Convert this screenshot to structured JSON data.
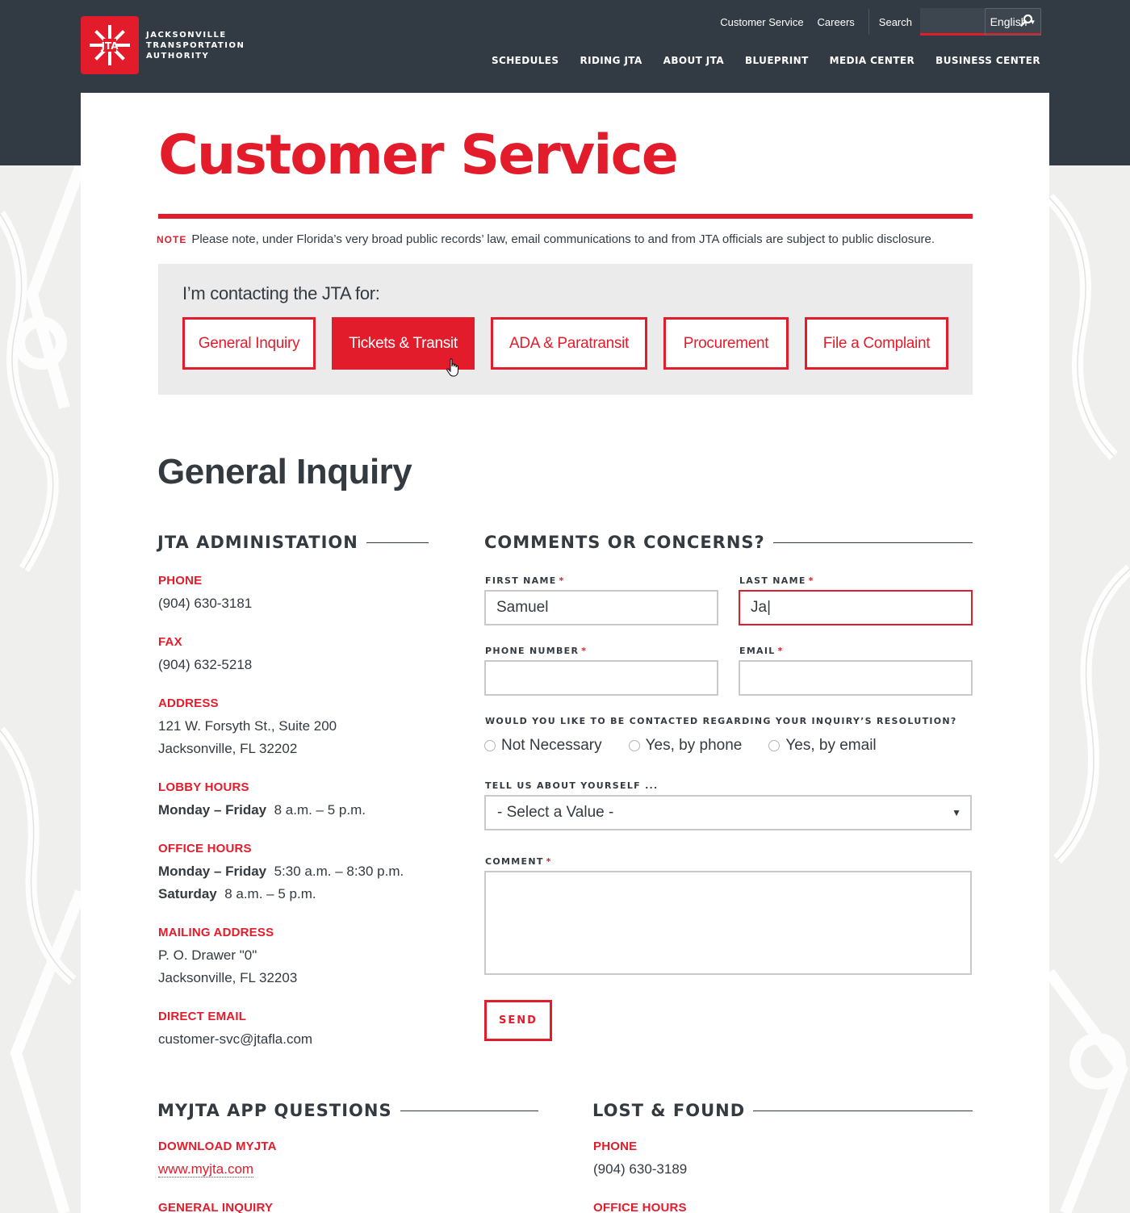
{
  "header": {
    "logo_lines": [
      "Jacksonville",
      "Transportation",
      "Authority"
    ],
    "utility_links": [
      "Customer Service",
      "Careers"
    ],
    "search_label": "Search",
    "search_value": "",
    "language": "English",
    "nav": [
      "SCHEDULES",
      "RIDING JTA",
      "ABOUT JTA",
      "BLUEPRINT",
      "MEDIA CENTER",
      "BUSINESS CENTER"
    ]
  },
  "page": {
    "title": "Customer Service",
    "note_tag": "NOTE",
    "note_text": "Please note, under Florida’s very broad public records’ law, email communications to and from JTA officials are subject to public disclosure."
  },
  "contact": {
    "prompt": "I’m contacting the JTA for:",
    "options": [
      {
        "label": "General Inquiry",
        "active": false
      },
      {
        "label": "Tickets & Transit",
        "active": true
      },
      {
        "label": "ADA & Paratransit",
        "active": false
      },
      {
        "label": "Procurement",
        "active": false
      },
      {
        "label": "File a Complaint",
        "active": false
      }
    ]
  },
  "section_heading": "General Inquiry",
  "administration": {
    "heading": "JTA ADMINISTATION",
    "phone_label": "PHONE",
    "phone": "(904) 630-3181",
    "fax_label": "FAX",
    "fax": "(904) 632-5218",
    "address_label": "ADDRESS",
    "address_line1": "121 W. Forsyth St., Suite 200",
    "address_line2": "Jacksonville, FL 32202",
    "lobby_label": "LOBBY HOURS",
    "lobby_days": "Monday – Friday",
    "lobby_time": "8 a.m. – 5 p.m.",
    "office_label": "OFFICE HOURS",
    "office_days1": "Monday – Friday",
    "office_time1": "5:30 a.m. – 8:30 p.m.",
    "office_days2": "Saturday",
    "office_time2": "8 a.m. – 5 p.m.",
    "mailing_label": "MAILING ADDRESS",
    "mailing_line1": "P. O. Drawer \"0\"",
    "mailing_line2": "Jacksonville, FL 32203",
    "email_label": "DIRECT EMAIL",
    "email": "customer-svc@jtafla.com"
  },
  "form": {
    "heading": "COMMENTS OR CONCERNS?",
    "first_name_label": "FIRST NAME",
    "first_name_value": "Samuel",
    "last_name_label": "LAST NAME",
    "last_name_value": "Ja|",
    "phone_label": "PHONE NUMBER",
    "phone_value": "",
    "email_label": "EMAIL",
    "email_value": "",
    "required_mark": "*",
    "contact_question": "WOULD YOU LIKE TO BE CONTACTED REGARDING YOUR INQUIRY’S RESOLUTION?",
    "contact_options": [
      "Not Necessary",
      "Yes, by phone",
      "Yes, by email"
    ],
    "about_label": "TELL US ABOUT YOURSELF ...",
    "about_value": "- Select a Value -",
    "comment_label": "COMMENT",
    "send_label": "SEND"
  },
  "myjta": {
    "heading": "MYJTA APP QUESTIONS",
    "download_label": "DOWNLOAD MYJTA",
    "download_link": "www.myjta.com",
    "general_label": "GENERAL INQUIRY"
  },
  "lost_found": {
    "heading": "LOST & FOUND",
    "phone_label": "PHONE",
    "phone": "(904) 630-3189",
    "office_label": "OFFICE HOURS"
  },
  "colors": {
    "accent": "#e31c2b",
    "header_bg": "#323b43",
    "text": "#333a40",
    "panel": "#ebebeb"
  }
}
